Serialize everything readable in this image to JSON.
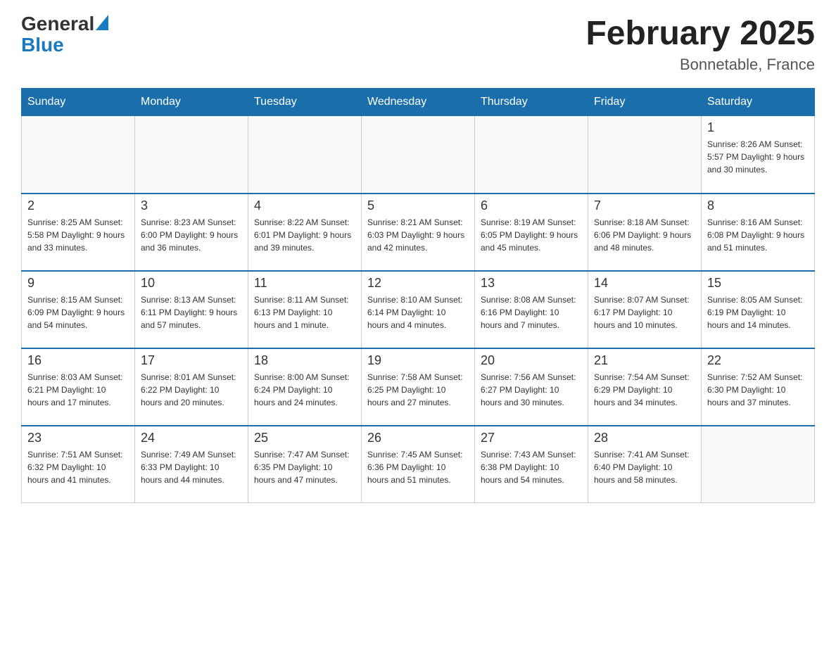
{
  "logo": {
    "general": "General",
    "blue": "Blue",
    "arrow": "▶"
  },
  "title": "February 2025",
  "subtitle": "Bonnetable, France",
  "days_of_week": [
    "Sunday",
    "Monday",
    "Tuesday",
    "Wednesday",
    "Thursday",
    "Friday",
    "Saturday"
  ],
  "weeks": [
    [
      {
        "day": "",
        "info": ""
      },
      {
        "day": "",
        "info": ""
      },
      {
        "day": "",
        "info": ""
      },
      {
        "day": "",
        "info": ""
      },
      {
        "day": "",
        "info": ""
      },
      {
        "day": "",
        "info": ""
      },
      {
        "day": "1",
        "info": "Sunrise: 8:26 AM\nSunset: 5:57 PM\nDaylight: 9 hours and 30 minutes."
      }
    ],
    [
      {
        "day": "2",
        "info": "Sunrise: 8:25 AM\nSunset: 5:58 PM\nDaylight: 9 hours and 33 minutes."
      },
      {
        "day": "3",
        "info": "Sunrise: 8:23 AM\nSunset: 6:00 PM\nDaylight: 9 hours and 36 minutes."
      },
      {
        "day": "4",
        "info": "Sunrise: 8:22 AM\nSunset: 6:01 PM\nDaylight: 9 hours and 39 minutes."
      },
      {
        "day": "5",
        "info": "Sunrise: 8:21 AM\nSunset: 6:03 PM\nDaylight: 9 hours and 42 minutes."
      },
      {
        "day": "6",
        "info": "Sunrise: 8:19 AM\nSunset: 6:05 PM\nDaylight: 9 hours and 45 minutes."
      },
      {
        "day": "7",
        "info": "Sunrise: 8:18 AM\nSunset: 6:06 PM\nDaylight: 9 hours and 48 minutes."
      },
      {
        "day": "8",
        "info": "Sunrise: 8:16 AM\nSunset: 6:08 PM\nDaylight: 9 hours and 51 minutes."
      }
    ],
    [
      {
        "day": "9",
        "info": "Sunrise: 8:15 AM\nSunset: 6:09 PM\nDaylight: 9 hours and 54 minutes."
      },
      {
        "day": "10",
        "info": "Sunrise: 8:13 AM\nSunset: 6:11 PM\nDaylight: 9 hours and 57 minutes."
      },
      {
        "day": "11",
        "info": "Sunrise: 8:11 AM\nSunset: 6:13 PM\nDaylight: 10 hours and 1 minute."
      },
      {
        "day": "12",
        "info": "Sunrise: 8:10 AM\nSunset: 6:14 PM\nDaylight: 10 hours and 4 minutes."
      },
      {
        "day": "13",
        "info": "Sunrise: 8:08 AM\nSunset: 6:16 PM\nDaylight: 10 hours and 7 minutes."
      },
      {
        "day": "14",
        "info": "Sunrise: 8:07 AM\nSunset: 6:17 PM\nDaylight: 10 hours and 10 minutes."
      },
      {
        "day": "15",
        "info": "Sunrise: 8:05 AM\nSunset: 6:19 PM\nDaylight: 10 hours and 14 minutes."
      }
    ],
    [
      {
        "day": "16",
        "info": "Sunrise: 8:03 AM\nSunset: 6:21 PM\nDaylight: 10 hours and 17 minutes."
      },
      {
        "day": "17",
        "info": "Sunrise: 8:01 AM\nSunset: 6:22 PM\nDaylight: 10 hours and 20 minutes."
      },
      {
        "day": "18",
        "info": "Sunrise: 8:00 AM\nSunset: 6:24 PM\nDaylight: 10 hours and 24 minutes."
      },
      {
        "day": "19",
        "info": "Sunrise: 7:58 AM\nSunset: 6:25 PM\nDaylight: 10 hours and 27 minutes."
      },
      {
        "day": "20",
        "info": "Sunrise: 7:56 AM\nSunset: 6:27 PM\nDaylight: 10 hours and 30 minutes."
      },
      {
        "day": "21",
        "info": "Sunrise: 7:54 AM\nSunset: 6:29 PM\nDaylight: 10 hours and 34 minutes."
      },
      {
        "day": "22",
        "info": "Sunrise: 7:52 AM\nSunset: 6:30 PM\nDaylight: 10 hours and 37 minutes."
      }
    ],
    [
      {
        "day": "23",
        "info": "Sunrise: 7:51 AM\nSunset: 6:32 PM\nDaylight: 10 hours and 41 minutes."
      },
      {
        "day": "24",
        "info": "Sunrise: 7:49 AM\nSunset: 6:33 PM\nDaylight: 10 hours and 44 minutes."
      },
      {
        "day": "25",
        "info": "Sunrise: 7:47 AM\nSunset: 6:35 PM\nDaylight: 10 hours and 47 minutes."
      },
      {
        "day": "26",
        "info": "Sunrise: 7:45 AM\nSunset: 6:36 PM\nDaylight: 10 hours and 51 minutes."
      },
      {
        "day": "27",
        "info": "Sunrise: 7:43 AM\nSunset: 6:38 PM\nDaylight: 10 hours and 54 minutes."
      },
      {
        "day": "28",
        "info": "Sunrise: 7:41 AM\nSunset: 6:40 PM\nDaylight: 10 hours and 58 minutes."
      },
      {
        "day": "",
        "info": ""
      }
    ]
  ]
}
